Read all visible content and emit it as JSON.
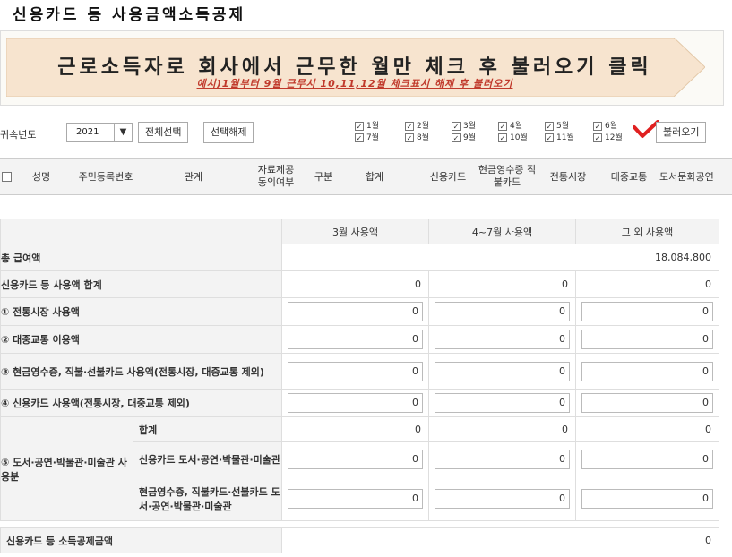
{
  "page_title": "신용카드 등 사용금액소득공제",
  "banner": {
    "main": "근로소득자로 회사에서 근무한 월만 체크 후 불러오기 클릭",
    "sub": "예시)1월부터 9월 근무시 10,11,12월 체크표시 해제 후 불러오기"
  },
  "toolbar": {
    "year_label": "귀속년도",
    "year_value": "2021",
    "select_all": "전체선택",
    "deselect": "선택해제",
    "months": [
      "1월",
      "2월",
      "3월",
      "4월",
      "5월",
      "6월",
      "7월",
      "8월",
      "9월",
      "10월",
      "11월",
      "12월"
    ],
    "load": "불러오기"
  },
  "grid_header": {
    "name": "성명",
    "rrn": "주민등록번호",
    "relation": "관계",
    "consent": "자료제공 동의여부",
    "category": "구분",
    "total": "합계",
    "credit": "신용카드",
    "cash_receipt": "현금영수증 직불카드",
    "market": "전통시장",
    "transit": "대중교통",
    "culture": "도서문화공연"
  },
  "summary": {
    "col_march": "3월 사용액",
    "col_apr_jul": "4~7월 사용액",
    "col_other": "그 외 사용액",
    "rows": [
      {
        "label": "총 급여액",
        "vals": [
          "",
          "",
          "18,084,800"
        ]
      },
      {
        "label": "신용카드 등 사용액 합계",
        "vals": [
          "0",
          "0",
          "0"
        ]
      },
      {
        "label": "① 전통시장 사용액",
        "vals": [
          "0",
          "0",
          "0"
        ]
      },
      {
        "label": "② 대중교통 이용액",
        "vals": [
          "0",
          "0",
          "0"
        ]
      },
      {
        "label": "③ 현금영수증, 직불·선불카드 사용액(전통시장, 대중교통 제외)",
        "vals": [
          "0",
          "0",
          "0"
        ]
      },
      {
        "label": "④ 신용카드 사용액(전통시장, 대중교통 제외)",
        "vals": [
          "0",
          "0",
          "0"
        ]
      }
    ],
    "culture_group": "⑤ 도서·공연·박물관·미술관 사용분",
    "culture_rows": [
      {
        "label": "합계",
        "vals": [
          "0",
          "0",
          "0"
        ]
      },
      {
        "label": "신용카드 도서·공연·박물관·미술관",
        "vals": [
          "0",
          "0",
          "0"
        ]
      },
      {
        "label": "현금영수증, 직불카드·선불카드 도서·공연·박물관·미술관",
        "vals": [
          "0",
          "0",
          "0"
        ]
      }
    ],
    "deduction_label": "신용카드 등 소득공제금액",
    "deduction_value": "0"
  }
}
